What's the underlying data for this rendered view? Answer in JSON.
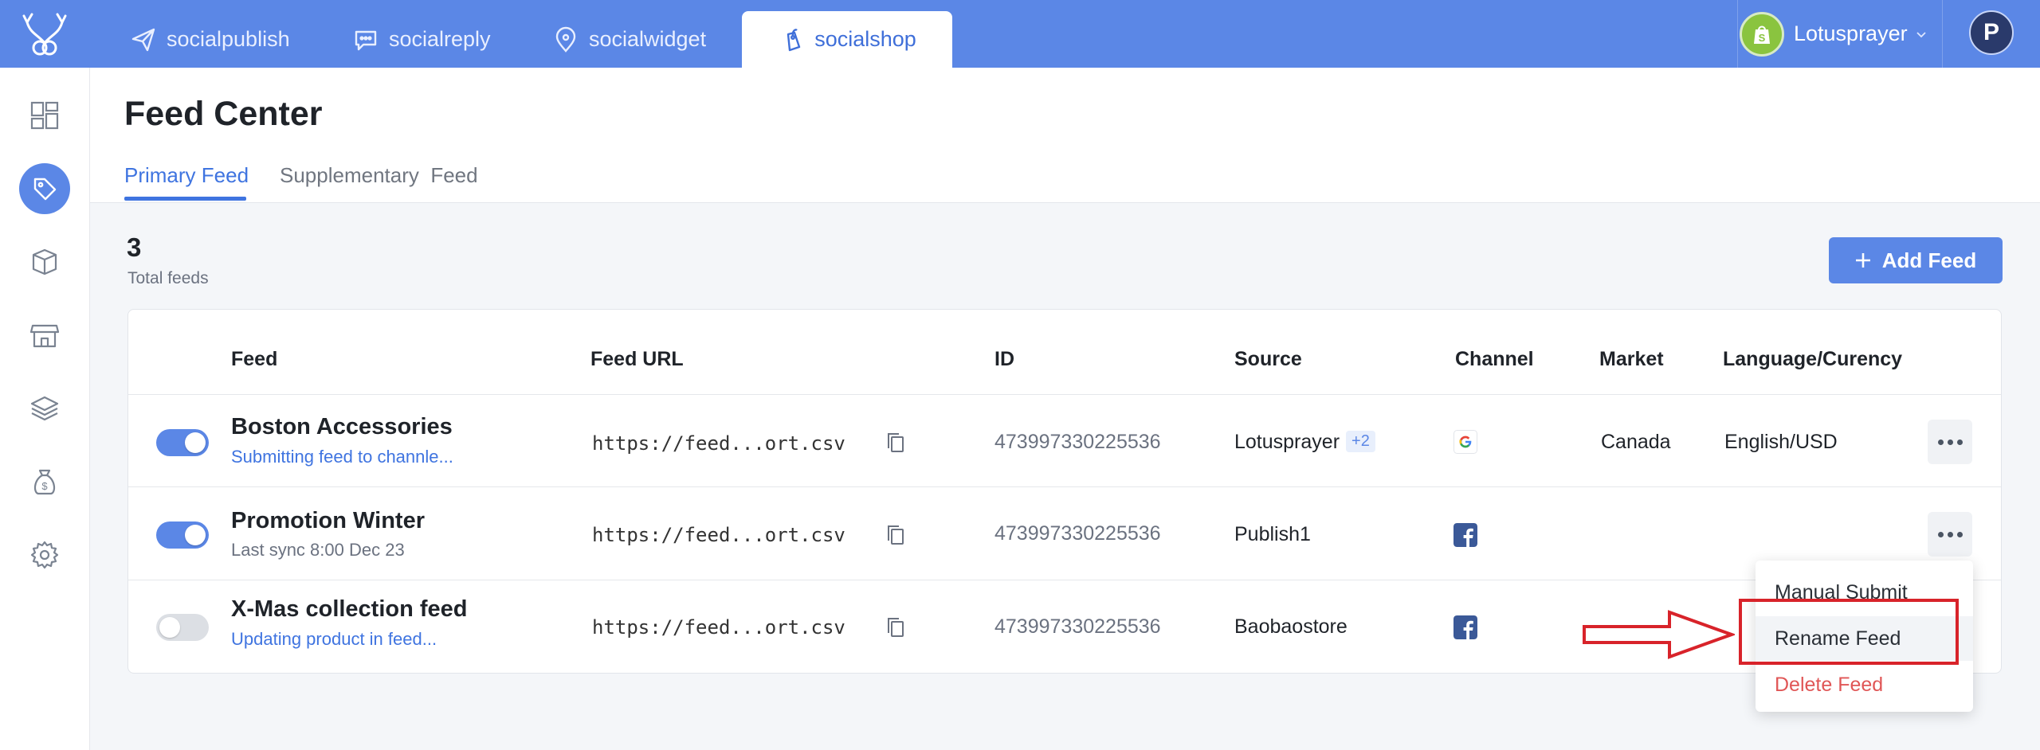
{
  "topbar": {
    "logo_icon": "antler-logo-icon",
    "apps": [
      {
        "label": "socialpublish",
        "icon": "paper-plane-icon"
      },
      {
        "label": "socialreply",
        "icon": "chat-bubble-icon"
      },
      {
        "label": "socialwidget",
        "icon": "map-pin-icon"
      },
      {
        "label": "socialshop",
        "icon": "shopping-tag-icon",
        "active": true
      }
    ],
    "account": {
      "name": "Lotusprayer",
      "icon": "shopify-bag-icon"
    },
    "avatar_letter": "P"
  },
  "sidebar": {
    "items": [
      {
        "icon": "dashboard-icon"
      },
      {
        "icon": "tag-icon",
        "active": true
      },
      {
        "icon": "box-icon"
      },
      {
        "icon": "storefront-icon"
      },
      {
        "icon": "layers-icon"
      },
      {
        "icon": "money-bag-icon"
      },
      {
        "icon": "gear-icon"
      }
    ]
  },
  "page": {
    "title": "Feed Center",
    "tabs": [
      "Primary Feed",
      "Supplementary  Feed"
    ]
  },
  "stats": {
    "total_count": "3",
    "total_label": "Total feeds"
  },
  "add_feed": {
    "label": "Add Feed",
    "icon": "plus-icon"
  },
  "table": {
    "headers": {
      "feed": "Feed",
      "url": "Feed URL",
      "id": "ID",
      "source": "Source",
      "channel": "Channel",
      "market": "Market",
      "language": "Language/Curency"
    },
    "rows": [
      {
        "enabled": true,
        "name": "Boston Accessories",
        "status": "Submitting feed to channle...",
        "status_color": "#3f74e0",
        "url": "https://feed...ort.csv",
        "id": "473997330225536",
        "source": "Lotusprayer",
        "source_extra": "+2",
        "channel": "google-icon",
        "market": "Canada",
        "language": "English/USD"
      },
      {
        "enabled": true,
        "name": "Promotion Winter",
        "status": "Last sync 8:00 Dec 23",
        "status_color": "#6b7280",
        "url": "https://feed...ort.csv",
        "id": "473997330225536",
        "source": "Publish1",
        "channel": "facebook-icon",
        "market": "",
        "language": ""
      },
      {
        "enabled": false,
        "name": "X-Mas collection feed",
        "status": "Updating product in feed...",
        "status_color": "#3f74e0",
        "url": "https://feed...ort.csv",
        "id": "473997330225536",
        "source": "Baobaostore",
        "channel": "facebook-icon",
        "market": "",
        "language": ""
      }
    ]
  },
  "row_menu": {
    "items": [
      "Manual Submit",
      "Rename Feed",
      "Delete Feed"
    ],
    "highlighted": "Rename Feed",
    "danger_color": "#e05656"
  },
  "colors": {
    "brand": "#5b87e6",
    "accent_text": "#3f74e0",
    "annotation": "#d8232a"
  }
}
